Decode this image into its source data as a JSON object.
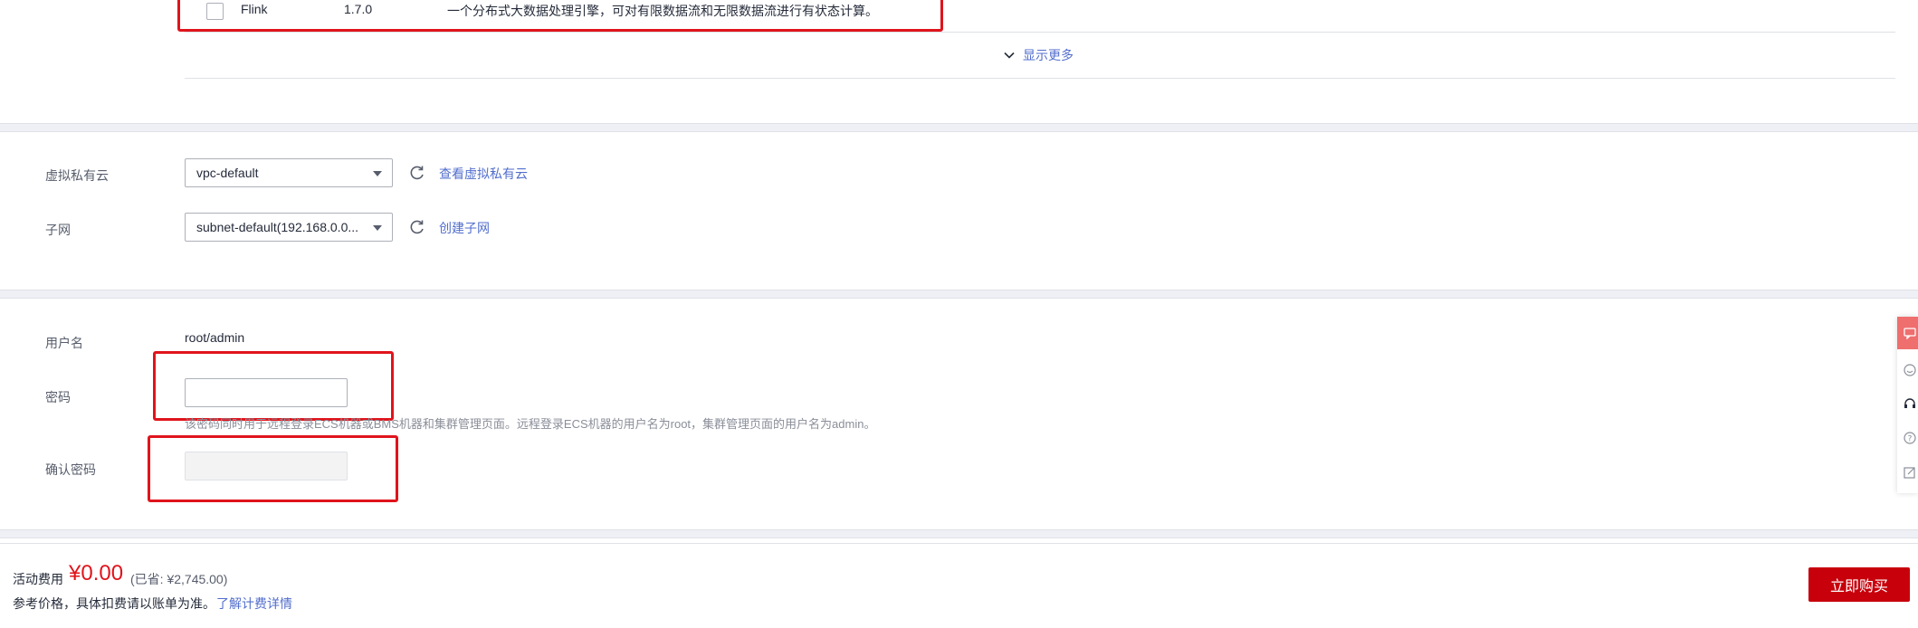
{
  "component": {
    "name": "Flink",
    "version": "1.7.0",
    "description": "一个分布式大数据处理引擎，可对有限数据流和无限数据流进行有状态计算。"
  },
  "show_more_label": "显示更多",
  "network": {
    "vpc_label": "虚拟私有云",
    "vpc_value": "vpc-default",
    "vpc_link": "查看虚拟私有云",
    "subnet_label": "子网",
    "subnet_value": "subnet-default(192.168.0.0...",
    "subnet_link": "创建子网"
  },
  "account": {
    "username_label": "用户名",
    "username_value": "root/admin",
    "password_label": "密码",
    "password_value": "",
    "password_hint": "该密码同时用于远程登录ECS机器或BMS机器和集群管理页面。远程登录ECS机器的用户名为root，集群管理页面的用户名为admin。",
    "confirm_label": "确认密码",
    "confirm_value": ""
  },
  "footer": {
    "fee_label": "活动费用",
    "fee_amount": "¥0.00",
    "saved_text": "(已省: ¥2,745.00)",
    "note": "参考价格，具体扣费请以账单为准。",
    "billing_link": "了解计费详情",
    "buy_label": "立即购买"
  },
  "colors": {
    "accent_link": "#526ecc",
    "highlight_red": "#e0141c",
    "buy_button": "#c7000b"
  },
  "icons": [
    "chevron-down-icon",
    "refresh-icon",
    "dropdown-arrow-icon",
    "chat-icon",
    "smile-icon",
    "headset-icon",
    "help-icon",
    "edit-icon"
  ]
}
